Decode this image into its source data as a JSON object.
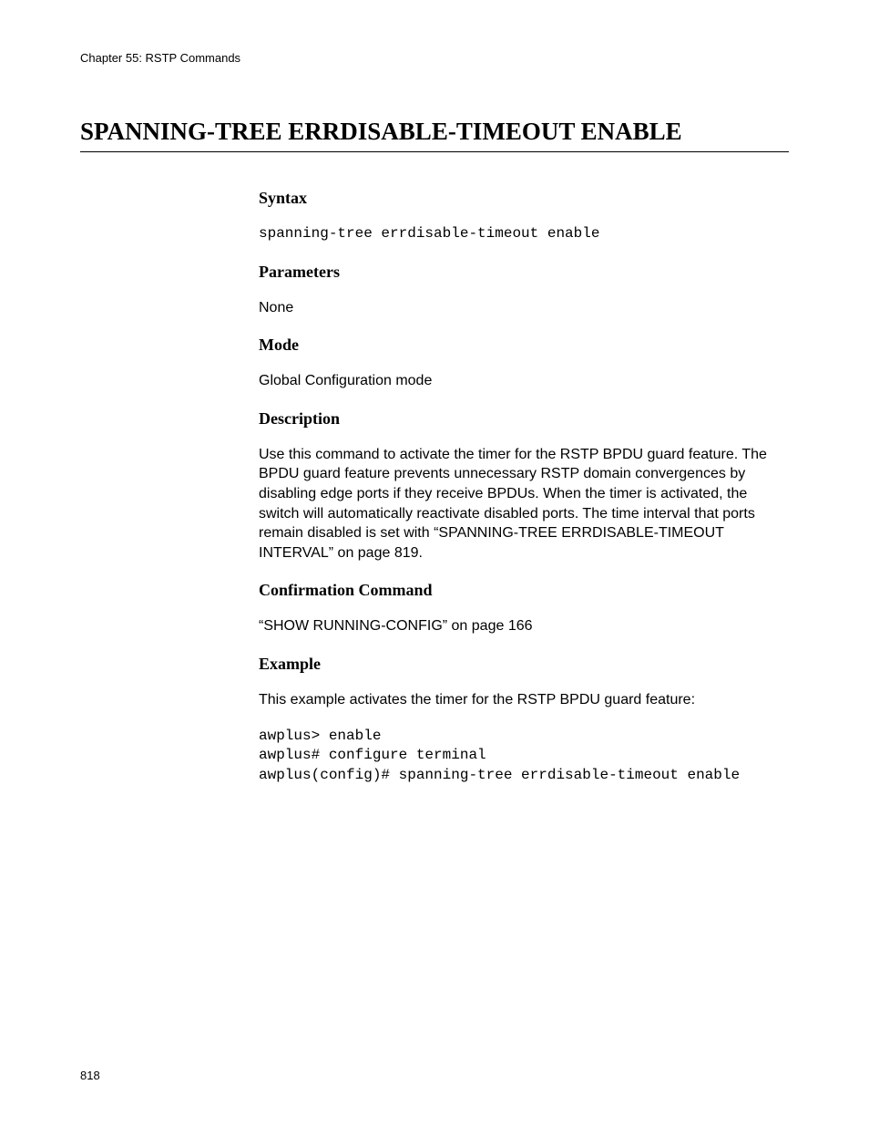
{
  "header": {
    "chapter": "Chapter 55: RSTP Commands"
  },
  "title": "SPANNING-TREE ERRDISABLE-TIMEOUT ENABLE",
  "sections": {
    "syntax": {
      "heading": "Syntax",
      "command": "spanning-tree errdisable-timeout enable"
    },
    "parameters": {
      "heading": "Parameters",
      "text": "None"
    },
    "mode": {
      "heading": "Mode",
      "text": "Global Configuration mode"
    },
    "description": {
      "heading": "Description",
      "text": "Use this command to activate the timer for the RSTP BPDU guard feature. The BPDU guard feature prevents unnecessary RSTP domain convergences by disabling edge ports if they receive BPDUs. When the timer is activated, the switch will automatically reactivate disabled ports. The time interval that ports remain disabled is set with “SPANNING-TREE ERRDISABLE-TIMEOUT INTERVAL” on page 819."
    },
    "confirmation": {
      "heading": "Confirmation Command",
      "text": "“SHOW RUNNING-CONFIG” on page 166"
    },
    "example": {
      "heading": "Example",
      "intro": "This example activates the timer for the RSTP BPDU guard feature:",
      "code": "awplus> enable\nawplus# configure terminal\nawplus(config)# spanning-tree errdisable-timeout enable"
    }
  },
  "footer": {
    "page_number": "818"
  }
}
